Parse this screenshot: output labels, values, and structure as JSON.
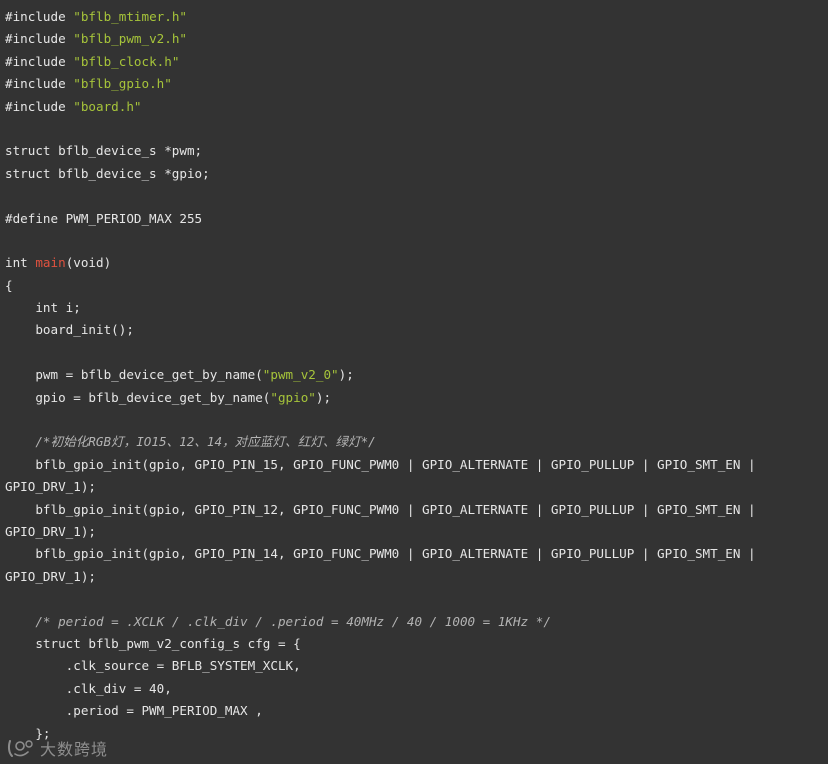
{
  "code": {
    "lines": [
      [
        {
          "t": "#include ",
          "c": "plain"
        },
        {
          "t": "\"bflb_mtimer.h\"",
          "c": "str"
        }
      ],
      [
        {
          "t": "#include ",
          "c": "plain"
        },
        {
          "t": "\"bflb_pwm_v2.h\"",
          "c": "str"
        }
      ],
      [
        {
          "t": "#include ",
          "c": "plain"
        },
        {
          "t": "\"bflb_clock.h\"",
          "c": "str"
        }
      ],
      [
        {
          "t": "#include ",
          "c": "plain"
        },
        {
          "t": "\"bflb_gpio.h\"",
          "c": "str"
        }
      ],
      [
        {
          "t": "#include ",
          "c": "plain"
        },
        {
          "t": "\"board.h\"",
          "c": "str"
        }
      ],
      [],
      [
        {
          "t": "struct bflb_device_s *pwm;",
          "c": "plain"
        }
      ],
      [
        {
          "t": "struct bflb_device_s *gpio;",
          "c": "plain"
        }
      ],
      [],
      [
        {
          "t": "#define PWM_PERIOD_MAX 255",
          "c": "plain"
        }
      ],
      [],
      [
        {
          "t": "int ",
          "c": "plain"
        },
        {
          "t": "main",
          "c": "fn"
        },
        {
          "t": "(void)",
          "c": "plain"
        }
      ],
      [
        {
          "t": "{",
          "c": "plain"
        }
      ],
      [
        {
          "t": "    int i;",
          "c": "plain"
        }
      ],
      [
        {
          "t": "    board_init();",
          "c": "plain"
        }
      ],
      [],
      [
        {
          "t": "    pwm = bflb_device_get_by_name(",
          "c": "plain"
        },
        {
          "t": "\"pwm_v2_0\"",
          "c": "str"
        },
        {
          "t": ");",
          "c": "plain"
        }
      ],
      [
        {
          "t": "    gpio = bflb_device_get_by_name(",
          "c": "plain"
        },
        {
          "t": "\"gpio\"",
          "c": "str"
        },
        {
          "t": ");",
          "c": "plain"
        }
      ],
      [],
      [
        {
          "t": "    ",
          "c": "plain"
        },
        {
          "t": "/*初始化RGB灯，IO15、12、14，对应蓝灯、红灯、绿灯*/",
          "c": "comment"
        }
      ],
      [
        {
          "t": "    bflb_gpio_init(gpio, GPIO_PIN_15, GPIO_FUNC_PWM0 | GPIO_ALTERNATE | GPIO_PULLUP | GPIO_SMT_EN |",
          "c": "plain"
        }
      ],
      [
        {
          "t": "GPIO_DRV_1);",
          "c": "plain"
        }
      ],
      [
        {
          "t": "    bflb_gpio_init(gpio, GPIO_PIN_12, GPIO_FUNC_PWM0 | GPIO_ALTERNATE | GPIO_PULLUP | GPIO_SMT_EN |",
          "c": "plain"
        }
      ],
      [
        {
          "t": "GPIO_DRV_1);",
          "c": "plain"
        }
      ],
      [
        {
          "t": "    bflb_gpio_init(gpio, GPIO_PIN_14, GPIO_FUNC_PWM0 | GPIO_ALTERNATE | GPIO_PULLUP | GPIO_SMT_EN |",
          "c": "plain"
        }
      ],
      [
        {
          "t": "GPIO_DRV_1);",
          "c": "plain"
        }
      ],
      [],
      [
        {
          "t": "    ",
          "c": "plain"
        },
        {
          "t": "/* period = .XCLK / .clk_div / .period = 40MHz / 40 / 1000 = 1KHz */",
          "c": "comment"
        }
      ],
      [
        {
          "t": "    struct bflb_pwm_v2_config_s cfg = {",
          "c": "plain"
        }
      ],
      [
        {
          "t": "        .clk_source = BFLB_SYSTEM_XCLK,",
          "c": "plain"
        }
      ],
      [
        {
          "t": "        .clk_div = 40,",
          "c": "plain"
        }
      ],
      [
        {
          "t": "        .period = PWM_PERIOD_MAX ,",
          "c": "plain"
        }
      ],
      [
        {
          "t": "    };",
          "c": "plain"
        }
      ]
    ]
  },
  "watermark": {
    "text": "大数跨境"
  },
  "colors": {
    "background": "#333333",
    "text": "#e6e6e6",
    "string": "#a6c43a",
    "function": "#e0523f",
    "comment": "#b3b3b3"
  }
}
